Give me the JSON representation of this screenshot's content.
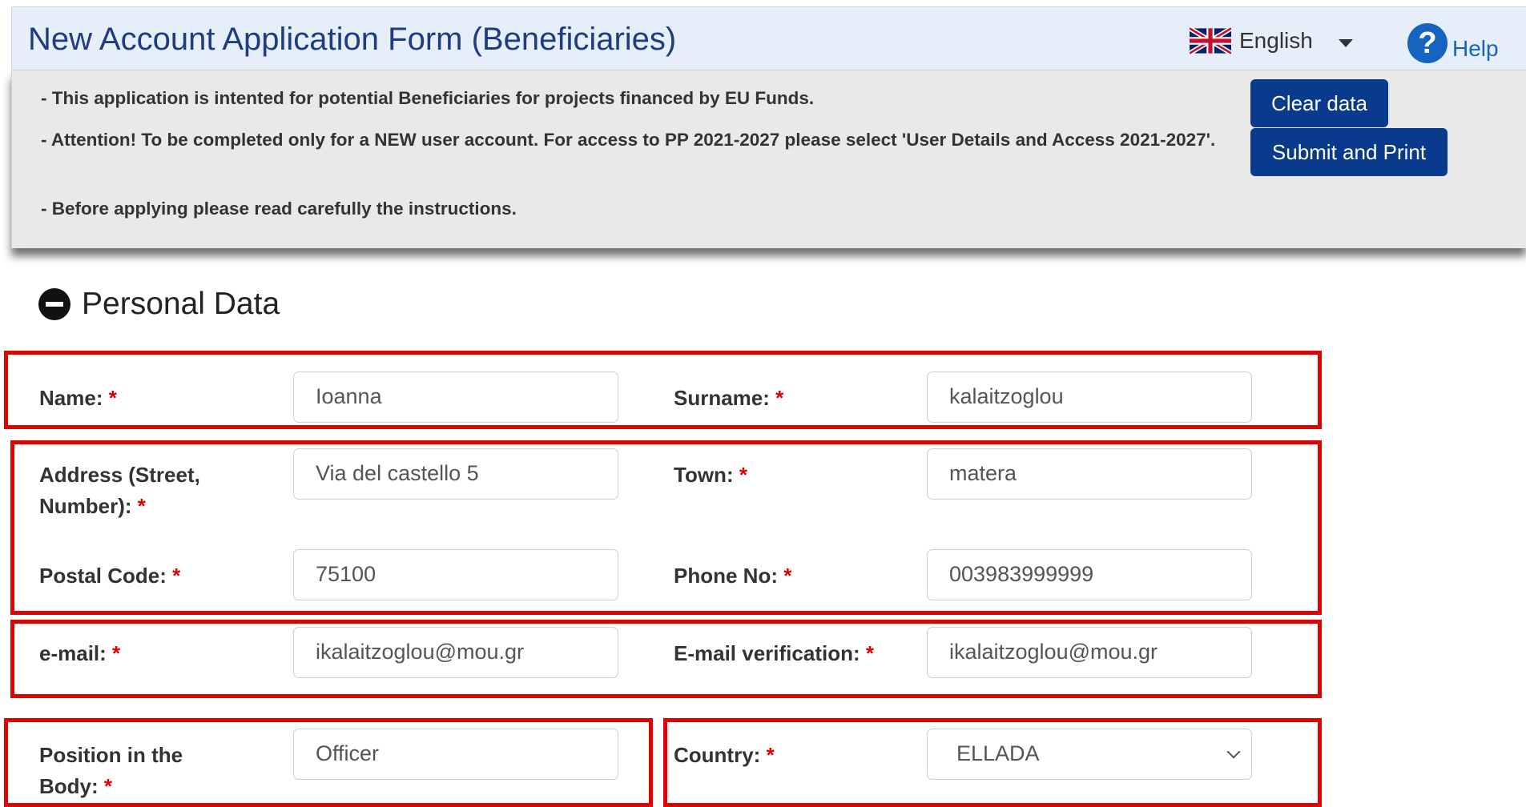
{
  "header": {
    "title": "New Account Application Form (Beneficiaries)",
    "language": "English",
    "help_label": "Help",
    "flag_icon": "uk-flag-icon"
  },
  "info": {
    "line1": "- This application is intented for potential Beneficiaries for projects financed by EU Funds.",
    "line2": "- Attention! To be completed only for a NEW user account. For access to PP 2021-2027 please select 'User Details and Access 2021-2027'.",
    "line3": "- Before applying please read carefully the instructions."
  },
  "buttons": {
    "clear": "Clear data",
    "submit": "Submit and Print"
  },
  "section": {
    "title": "Personal Data",
    "icon": "collapse-minus-icon"
  },
  "fields": {
    "name": {
      "label": "Name:",
      "value": "Ioanna"
    },
    "surname": {
      "label": "Surname:",
      "value": "kalaitzoglou"
    },
    "address": {
      "label": "Address (Street, Number):",
      "value": "Via del castello 5"
    },
    "town": {
      "label": "Town:",
      "value": "matera"
    },
    "postal": {
      "label": "Postal Code:",
      "value": "75100"
    },
    "phone": {
      "label": "Phone No:",
      "value": "003983999999"
    },
    "email": {
      "label": "e-mail:",
      "value": "ikalaitzoglou@mou.gr"
    },
    "email_verify": {
      "label": "E-mail verification:",
      "value": "ikalaitzoglou@mou.gr"
    },
    "position": {
      "label": "Position in the Body:",
      "value": "Officer"
    },
    "country": {
      "label": "Country:",
      "value": "ELLADA"
    }
  },
  "required_marker": "*",
  "colors": {
    "header_title": "#1f3c82",
    "button_bg": "#0a3a8c",
    "highlight": "#e00000",
    "help": "#1565c0"
  }
}
